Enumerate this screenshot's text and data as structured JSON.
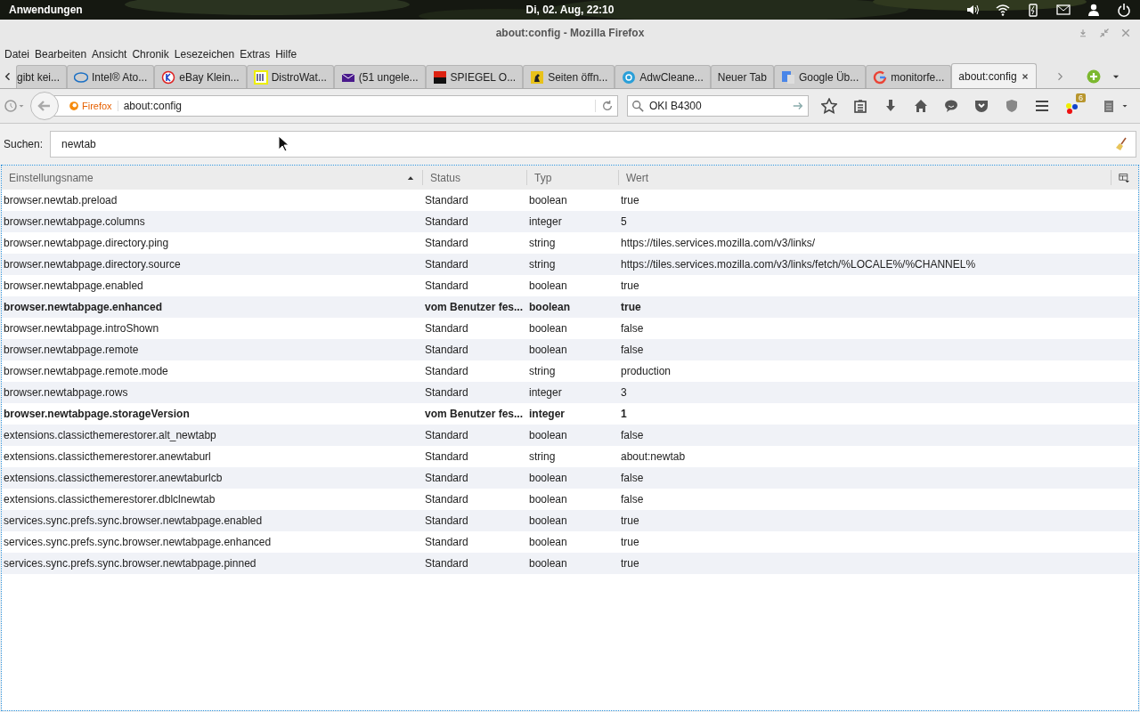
{
  "top_panel": {
    "menu": "Anwendungen",
    "clock": "Di, 02. Aug, 22:10"
  },
  "window": {
    "title": "about:config - Mozilla Firefox"
  },
  "menu_bar": [
    "Datei",
    "Bearbeiten",
    "Ansicht",
    "Chronik",
    "Lesezeichen",
    "Extras",
    "Hilfe"
  ],
  "tabs": [
    {
      "label": "gibt kei...",
      "selected": false
    },
    {
      "label": "Intel® Ato...",
      "selected": false
    },
    {
      "label": "eBay Klein...",
      "selected": false
    },
    {
      "label": "DistroWat...",
      "selected": false
    },
    {
      "label": "(51 ungele...",
      "selected": false
    },
    {
      "label": "SPIEGEL O...",
      "selected": false
    },
    {
      "label": "Seiten öffn...",
      "selected": false
    },
    {
      "label": "AdwCleane...",
      "selected": false
    },
    {
      "label": "Neuer Tab",
      "selected": false
    },
    {
      "label": "Google Üb...",
      "selected": false
    },
    {
      "label": "monitorfe...",
      "selected": false
    },
    {
      "label": "about:config",
      "selected": true
    }
  ],
  "navigation": {
    "identity": "Firefox",
    "url": "about:config",
    "search_value": "OKI B4300",
    "addon_badge": "6"
  },
  "filter": {
    "label": "Suchen:",
    "value": "newtab"
  },
  "table": {
    "columns": [
      "Einstellungsname",
      "Status",
      "Typ",
      "Wert"
    ],
    "rows": [
      {
        "name": "browser.newtab.preload",
        "status": "Standard",
        "type": "boolean",
        "value": "true",
        "modified": false
      },
      {
        "name": "browser.newtabpage.columns",
        "status": "Standard",
        "type": "integer",
        "value": "5",
        "modified": false
      },
      {
        "name": "browser.newtabpage.directory.ping",
        "status": "Standard",
        "type": "string",
        "value": "https://tiles.services.mozilla.com/v3/links/",
        "modified": false
      },
      {
        "name": "browser.newtabpage.directory.source",
        "status": "Standard",
        "type": "string",
        "value": "https://tiles.services.mozilla.com/v3/links/fetch/%LOCALE%/%CHANNEL%",
        "modified": false
      },
      {
        "name": "browser.newtabpage.enabled",
        "status": "Standard",
        "type": "boolean",
        "value": "true",
        "modified": false
      },
      {
        "name": "browser.newtabpage.enhanced",
        "status": "vom Benutzer fes...",
        "type": "boolean",
        "value": "true",
        "modified": true
      },
      {
        "name": "browser.newtabpage.introShown",
        "status": "Standard",
        "type": "boolean",
        "value": "false",
        "modified": false
      },
      {
        "name": "browser.newtabpage.remote",
        "status": "Standard",
        "type": "boolean",
        "value": "false",
        "modified": false
      },
      {
        "name": "browser.newtabpage.remote.mode",
        "status": "Standard",
        "type": "string",
        "value": "production",
        "modified": false
      },
      {
        "name": "browser.newtabpage.rows",
        "status": "Standard",
        "type": "integer",
        "value": "3",
        "modified": false
      },
      {
        "name": "browser.newtabpage.storageVersion",
        "status": "vom Benutzer fes...",
        "type": "integer",
        "value": "1",
        "modified": true
      },
      {
        "name": "extensions.classicthemerestorer.alt_newtabp",
        "status": "Standard",
        "type": "boolean",
        "value": "false",
        "modified": false
      },
      {
        "name": "extensions.classicthemerestorer.anewtaburl",
        "status": "Standard",
        "type": "string",
        "value": "about:newtab",
        "modified": false
      },
      {
        "name": "extensions.classicthemerestorer.anewtaburlcb",
        "status": "Standard",
        "type": "boolean",
        "value": "false",
        "modified": false
      },
      {
        "name": "extensions.classicthemerestorer.dblclnewtab",
        "status": "Standard",
        "type": "boolean",
        "value": "false",
        "modified": false
      },
      {
        "name": "services.sync.prefs.sync.browser.newtabpage.enabled",
        "status": "Standard",
        "type": "boolean",
        "value": "true",
        "modified": false
      },
      {
        "name": "services.sync.prefs.sync.browser.newtabpage.enhanced",
        "status": "Standard",
        "type": "boolean",
        "value": "true",
        "modified": false
      },
      {
        "name": "services.sync.prefs.sync.browser.newtabpage.pinned",
        "status": "Standard",
        "type": "boolean",
        "value": "true",
        "modified": false
      }
    ]
  }
}
